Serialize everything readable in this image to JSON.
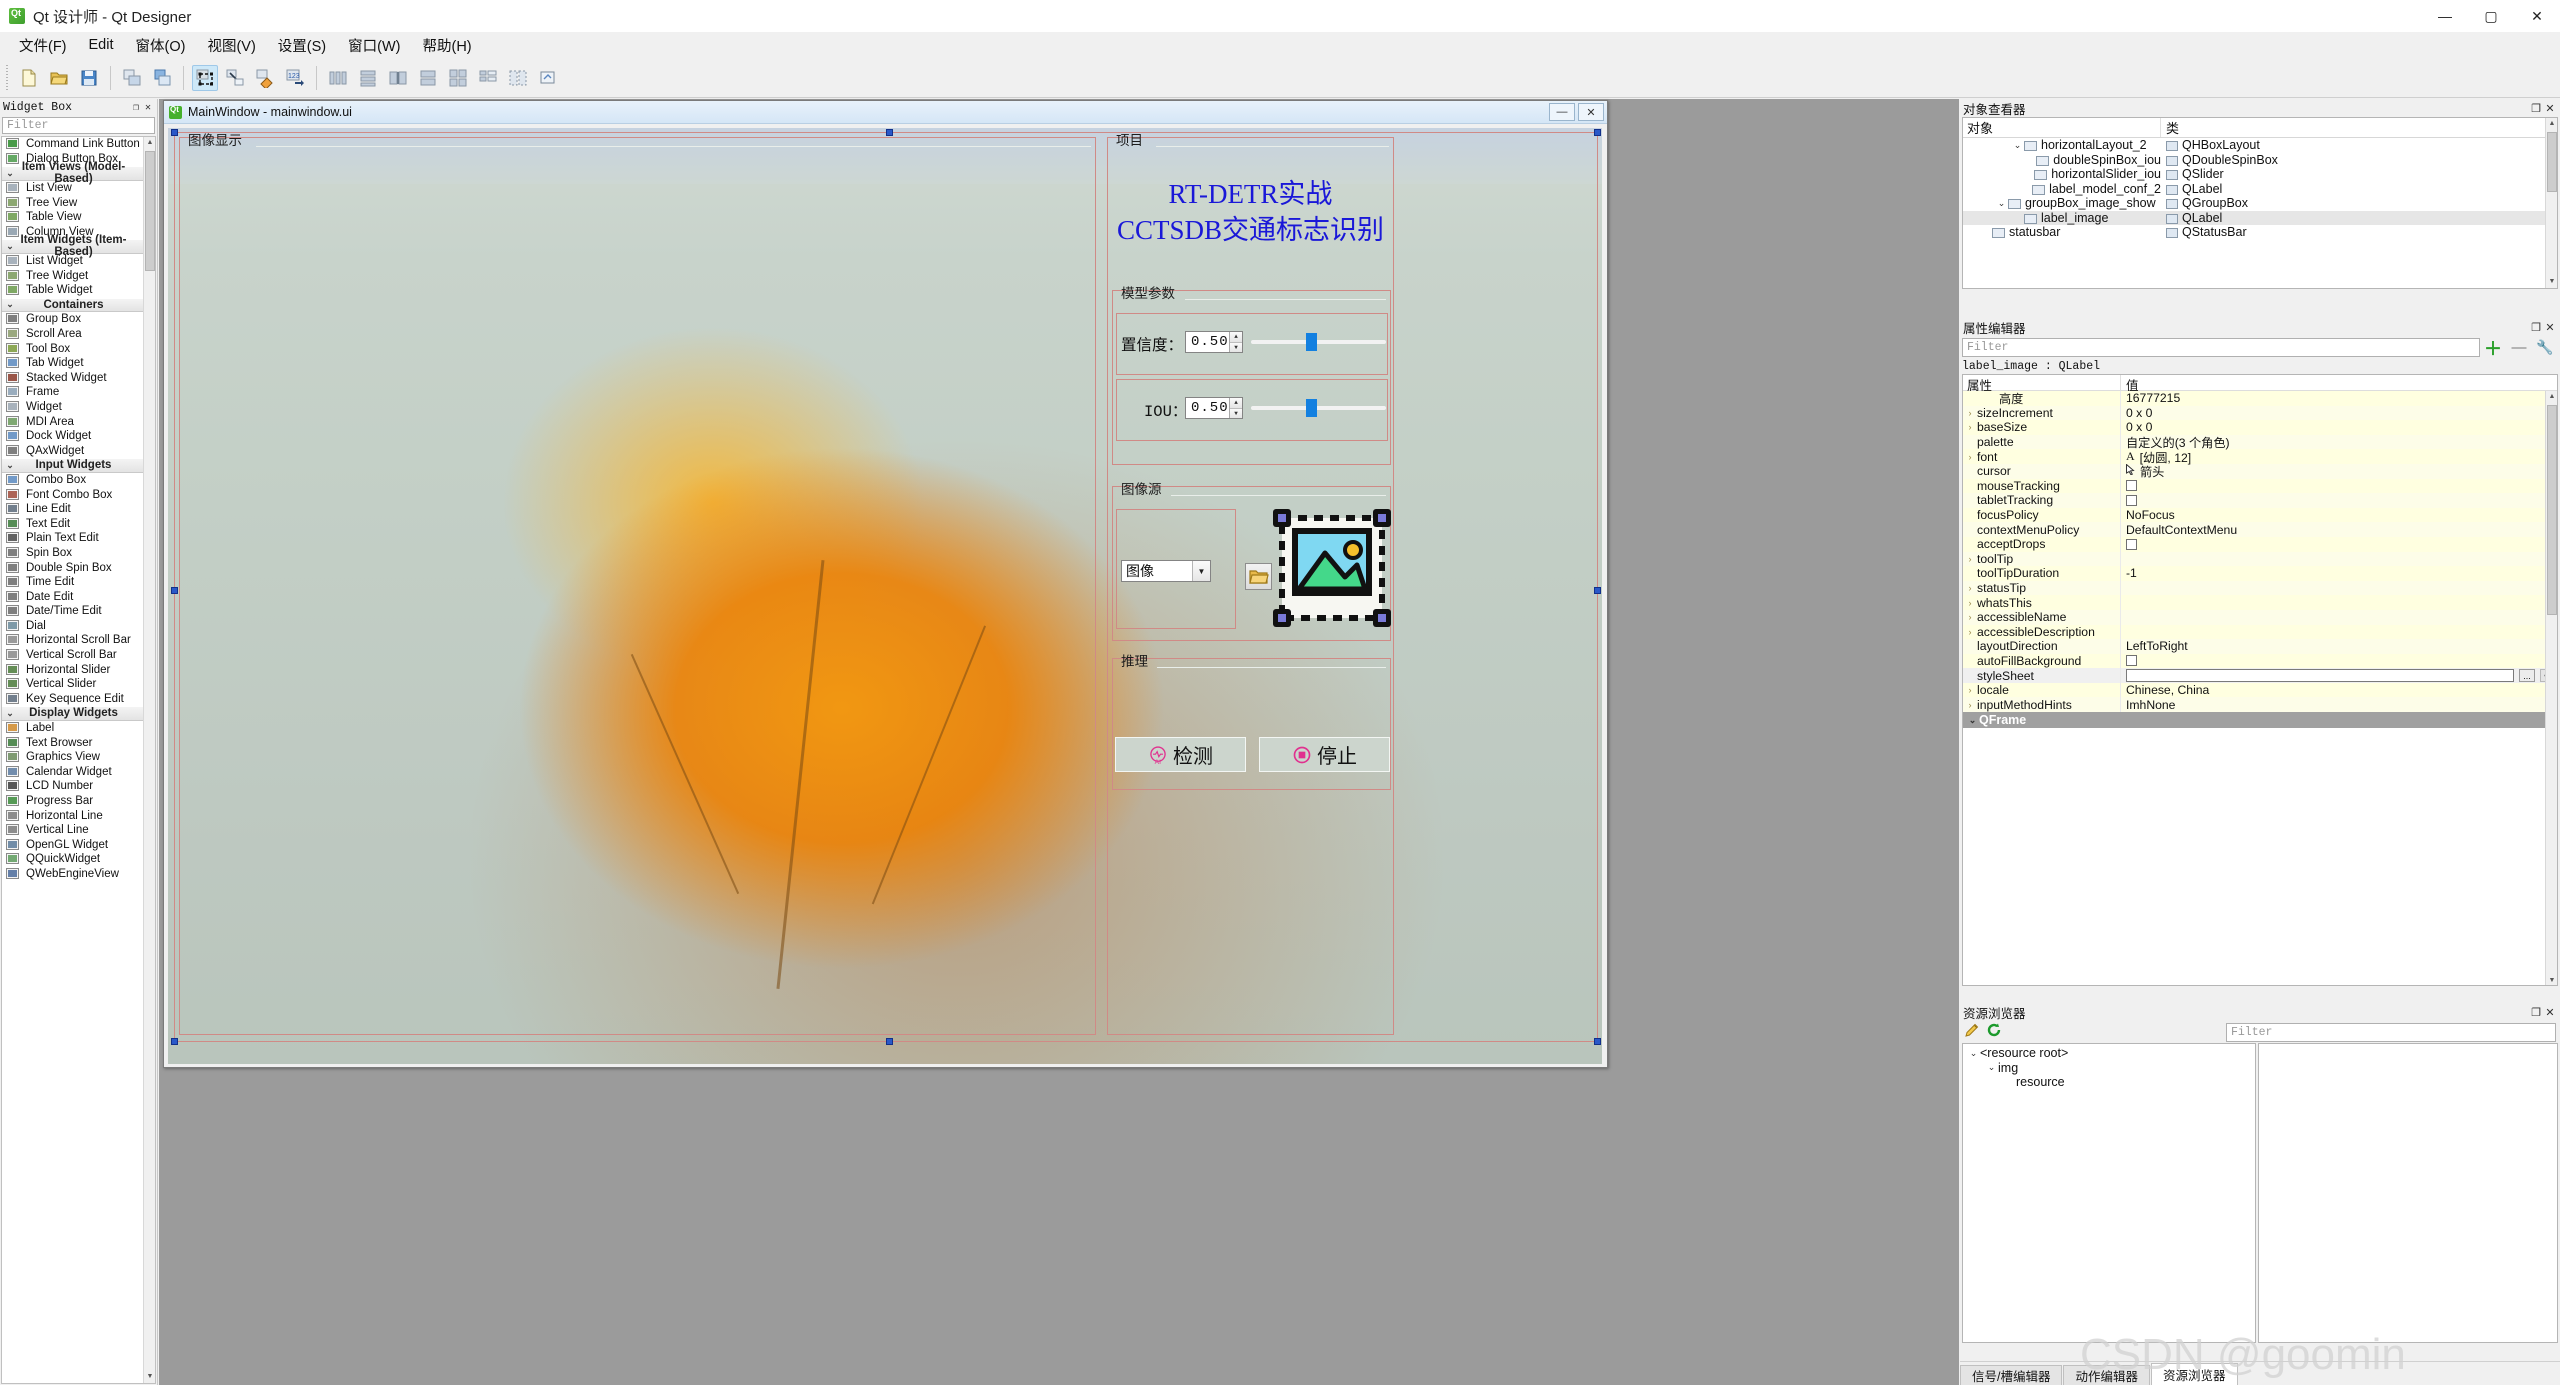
{
  "window": {
    "title": "Qt 设计师 - Qt Designer",
    "icon": "qt-icon",
    "minimize": "—",
    "maximize": "▢",
    "close": "✕"
  },
  "menubar": {
    "items": [
      {
        "label": "文件(F)",
        "name": "menu-file"
      },
      {
        "label": "Edit",
        "name": "menu-edit"
      },
      {
        "label": "窗体(O)",
        "name": "menu-form"
      },
      {
        "label": "视图(V)",
        "name": "menu-view"
      },
      {
        "label": "设置(S)",
        "name": "menu-settings"
      },
      {
        "label": "窗口(W)",
        "name": "menu-window"
      },
      {
        "label": "帮助(H)",
        "name": "menu-help"
      }
    ]
  },
  "toolbar": {
    "buttons": [
      {
        "name": "new-form-button",
        "icon": "new-file-icon"
      },
      {
        "name": "open-form-button",
        "icon": "open-folder-icon"
      },
      {
        "name": "save-form-button",
        "icon": "save-disk-icon"
      },
      {
        "name": "cut-copy-button",
        "icon": "copy-windows-icon"
      },
      {
        "name": "paste-button",
        "icon": "paste-window-icon"
      },
      {
        "name": "edit-widgets-button",
        "icon": "edit-widgets-icon",
        "active": true
      },
      {
        "name": "edit-signals-slots-button",
        "icon": "signal-slot-icon"
      },
      {
        "name": "edit-buddies-button",
        "icon": "buddy-icon"
      },
      {
        "name": "edit-tab-order-button",
        "icon": "tab-order-icon"
      },
      {
        "name": "layout-horizontally-button",
        "icon": "layout-h-icon"
      },
      {
        "name": "layout-vertically-button",
        "icon": "layout-v-icon"
      },
      {
        "name": "layout-splitter-h-button",
        "icon": "splitter-h-icon"
      },
      {
        "name": "layout-splitter-v-button",
        "icon": "splitter-v-icon"
      },
      {
        "name": "layout-grid-button",
        "icon": "layout-grid-icon"
      },
      {
        "name": "layout-form-button",
        "icon": "layout-form-icon"
      },
      {
        "name": "break-layout-button",
        "icon": "break-layout-icon"
      },
      {
        "name": "adjust-size-button",
        "icon": "adjust-size-icon"
      }
    ]
  },
  "widget_box": {
    "title": "Widget Box",
    "filter_placeholder": "Filter",
    "float_button": "❐",
    "close_button": "✕",
    "entries": [
      {
        "type": "item",
        "label": "Command Link Button",
        "icon": "command-link-icon"
      },
      {
        "type": "item",
        "label": "Dialog Button Box",
        "icon": "dialog-buttonbox-icon"
      },
      {
        "type": "group",
        "label": "Item Views (Model-Based)",
        "chevron": "⌄"
      },
      {
        "type": "item",
        "label": "List View",
        "icon": "list-view-icon"
      },
      {
        "type": "item",
        "label": "Tree View",
        "icon": "tree-view-icon"
      },
      {
        "type": "item",
        "label": "Table View",
        "icon": "table-view-icon"
      },
      {
        "type": "item",
        "label": "Column View",
        "icon": "column-view-icon"
      },
      {
        "type": "group",
        "label": "Item Widgets (Item-Based)",
        "chevron": "⌄"
      },
      {
        "type": "item",
        "label": "List Widget",
        "icon": "list-widget-icon"
      },
      {
        "type": "item",
        "label": "Tree Widget",
        "icon": "tree-widget-icon"
      },
      {
        "type": "item",
        "label": "Table Widget",
        "icon": "table-widget-icon"
      },
      {
        "type": "group",
        "label": "Containers",
        "chevron": "⌄"
      },
      {
        "type": "item",
        "label": "Group Box",
        "icon": "group-box-icon"
      },
      {
        "type": "item",
        "label": "Scroll Area",
        "icon": "scroll-area-icon"
      },
      {
        "type": "item",
        "label": "Tool Box",
        "icon": "tool-box-icon"
      },
      {
        "type": "item",
        "label": "Tab Widget",
        "icon": "tab-widget-icon"
      },
      {
        "type": "item",
        "label": "Stacked Widget",
        "icon": "stacked-widget-icon"
      },
      {
        "type": "item",
        "label": "Frame",
        "icon": "frame-icon"
      },
      {
        "type": "item",
        "label": "Widget",
        "icon": "widget-icon"
      },
      {
        "type": "item",
        "label": "MDI Area",
        "icon": "mdi-area-icon"
      },
      {
        "type": "item",
        "label": "Dock Widget",
        "icon": "dock-widget-icon"
      },
      {
        "type": "item",
        "label": "QAxWidget",
        "icon": "qaxwidget-icon"
      },
      {
        "type": "group",
        "label": "Input Widgets",
        "chevron": "⌄"
      },
      {
        "type": "item",
        "label": "Combo Box",
        "icon": "combo-box-icon"
      },
      {
        "type": "item",
        "label": "Font Combo Box",
        "icon": "font-combo-box-icon"
      },
      {
        "type": "item",
        "label": "Line Edit",
        "icon": "line-edit-icon"
      },
      {
        "type": "item",
        "label": "Text Edit",
        "icon": "text-edit-icon"
      },
      {
        "type": "item",
        "label": "Plain Text Edit",
        "icon": "plain-text-edit-icon"
      },
      {
        "type": "item",
        "label": "Spin Box",
        "icon": "spin-box-icon"
      },
      {
        "type": "item",
        "label": "Double Spin Box",
        "icon": "double-spin-box-icon"
      },
      {
        "type": "item",
        "label": "Time Edit",
        "icon": "time-edit-icon"
      },
      {
        "type": "item",
        "label": "Date Edit",
        "icon": "date-edit-icon"
      },
      {
        "type": "item",
        "label": "Date/Time Edit",
        "icon": "datetime-edit-icon"
      },
      {
        "type": "item",
        "label": "Dial",
        "icon": "dial-icon"
      },
      {
        "type": "item",
        "label": "Horizontal Scroll Bar",
        "icon": "hscrollbar-icon"
      },
      {
        "type": "item",
        "label": "Vertical Scroll Bar",
        "icon": "vscrollbar-icon"
      },
      {
        "type": "item",
        "label": "Horizontal Slider",
        "icon": "hslider-icon"
      },
      {
        "type": "item",
        "label": "Vertical Slider",
        "icon": "vslider-icon"
      },
      {
        "type": "item",
        "label": "Key Sequence Edit",
        "icon": "key-sequence-icon"
      },
      {
        "type": "group",
        "label": "Display Widgets",
        "chevron": "⌄"
      },
      {
        "type": "item",
        "label": "Label",
        "icon": "label-icon"
      },
      {
        "type": "item",
        "label": "Text Browser",
        "icon": "text-browser-icon"
      },
      {
        "type": "item",
        "label": "Graphics View",
        "icon": "graphics-view-icon"
      },
      {
        "type": "item",
        "label": "Calendar Widget",
        "icon": "calendar-widget-icon"
      },
      {
        "type": "item",
        "label": "LCD Number",
        "icon": "lcd-number-icon"
      },
      {
        "type": "item",
        "label": "Progress Bar",
        "icon": "progress-bar-icon"
      },
      {
        "type": "item",
        "label": "Horizontal Line",
        "icon": "hline-icon"
      },
      {
        "type": "item",
        "label": "Vertical Line",
        "icon": "vline-icon"
      },
      {
        "type": "item",
        "label": "OpenGL Widget",
        "icon": "opengl-widget-icon"
      },
      {
        "type": "item",
        "label": "QQuickWidget",
        "icon": "qquickwidget-icon"
      },
      {
        "type": "item",
        "label": "QWebEngineView",
        "icon": "qwebengineview-icon"
      }
    ]
  },
  "form_window": {
    "title": "MainWindow - mainwindow.ui",
    "icon": "qt-icon",
    "minimize": "—",
    "close": "✕",
    "left_group_title": "图像显示",
    "right_group_title": "项目",
    "app_title_line1": "RT-DETR实战",
    "app_title_line2": "CCTSDB交通标志识别",
    "model_params": {
      "group_title": "模型参数",
      "conf_label": "置信度：",
      "conf_value": "0.50",
      "iou_label": "IOU：",
      "iou_value": "0.50"
    },
    "image_source": {
      "group_title": "图像源",
      "combo_value": "图像",
      "combo_arrow": "▼",
      "browse_icon": "open-folder-icon",
      "placeholder_icon": "image-placeholder-icon"
    },
    "inference": {
      "group_title": "推理",
      "detect_label": "检测",
      "detect_icon": "ai-detect-icon",
      "stop_label": "停止",
      "stop_icon": "stop-circle-icon"
    }
  },
  "object_inspector": {
    "title": "对象查看器",
    "float_button": "❐",
    "close_button": "✕",
    "columns": [
      "对象",
      "类"
    ],
    "rows": [
      {
        "indent": 3,
        "chevron": "⌄",
        "object": "horizontalLayout_2",
        "class": "QHBoxLayout",
        "icon": "hbox-layout-icon",
        "selected": false
      },
      {
        "indent": 4,
        "chevron": "",
        "object": "doubleSpinBox_iou",
        "class": "QDoubleSpinBox",
        "icon": "double-spin-box-icon",
        "selected": false
      },
      {
        "indent": 4,
        "chevron": "",
        "object": "horizontalSlider_iou",
        "class": "QSlider",
        "icon": "hslider-icon",
        "selected": false
      },
      {
        "indent": 4,
        "chevron": "",
        "object": "label_model_conf_2",
        "class": "QLabel",
        "icon": "label-icon",
        "selected": false
      },
      {
        "indent": 2,
        "chevron": "⌄",
        "object": "groupBox_image_show",
        "class": "QGroupBox",
        "icon": "group-box-icon",
        "selected": false
      },
      {
        "indent": 3,
        "chevron": "",
        "object": "label_image",
        "class": "QLabel",
        "icon": "label-icon",
        "selected": true
      },
      {
        "indent": 1,
        "chevron": "",
        "object": "statusbar",
        "class": "QStatusBar",
        "icon": "statusbar-icon",
        "selected": false
      }
    ]
  },
  "property_editor": {
    "title": "属性编辑器",
    "float_button": "❐",
    "close_button": "✕",
    "filter_placeholder": "Filter",
    "add_button": "＋",
    "remove_button": "—",
    "configure_button": "🔧",
    "object_line": "label_image : QLabel",
    "columns": [
      "属性",
      "值"
    ],
    "rows": [
      {
        "expand": "",
        "name": "高度",
        "value": "16777215",
        "kind": "text",
        "indent": true
      },
      {
        "expand": "›",
        "name": "sizeIncrement",
        "value": "0 x 0",
        "kind": "text"
      },
      {
        "expand": "›",
        "name": "baseSize",
        "value": "0 x 0",
        "kind": "text"
      },
      {
        "expand": "",
        "name": "palette",
        "value": "自定义的(3 个角色)",
        "kind": "text"
      },
      {
        "expand": "›",
        "name": "font",
        "value": "[幼圆, 12]",
        "kind": "font"
      },
      {
        "expand": "",
        "name": "cursor",
        "value": "箭头",
        "kind": "cursor"
      },
      {
        "expand": "",
        "name": "mouseTracking",
        "value": "",
        "kind": "checkbox"
      },
      {
        "expand": "",
        "name": "tabletTracking",
        "value": "",
        "kind": "checkbox"
      },
      {
        "expand": "",
        "name": "focusPolicy",
        "value": "NoFocus",
        "kind": "text"
      },
      {
        "expand": "",
        "name": "contextMenuPolicy",
        "value": "DefaultContextMenu",
        "kind": "text"
      },
      {
        "expand": "",
        "name": "acceptDrops",
        "value": "",
        "kind": "checkbox"
      },
      {
        "expand": "›",
        "name": "toolTip",
        "value": "",
        "kind": "text"
      },
      {
        "expand": "",
        "name": "toolTipDuration",
        "value": "-1",
        "kind": "text"
      },
      {
        "expand": "›",
        "name": "statusTip",
        "value": "",
        "kind": "text"
      },
      {
        "expand": "›",
        "name": "whatsThis",
        "value": "",
        "kind": "text"
      },
      {
        "expand": "›",
        "name": "accessibleName",
        "value": "",
        "kind": "text"
      },
      {
        "expand": "›",
        "name": "accessibleDescription",
        "value": "",
        "kind": "text"
      },
      {
        "expand": "",
        "name": "layoutDirection",
        "value": "LeftToRight",
        "kind": "text"
      },
      {
        "expand": "",
        "name": "autoFillBackground",
        "value": "",
        "kind": "checkbox"
      },
      {
        "expand": "",
        "name": "styleSheet",
        "value": "",
        "kind": "stylesheet",
        "ellipsis": "...",
        "reset": "↩"
      },
      {
        "expand": "›",
        "name": "locale",
        "value": "Chinese, China",
        "kind": "text"
      },
      {
        "expand": "›",
        "name": "inputMethodHints",
        "value": "ImhNone",
        "kind": "text"
      }
    ],
    "section_row": {
      "chevron": "⌄",
      "label": "QFrame"
    }
  },
  "resource_browser": {
    "title": "资源浏览器",
    "float_button": "❐",
    "close_button": "✕",
    "edit_icon": "pencil-icon",
    "reload_icon": "reload-icon",
    "filter_placeholder": "Filter",
    "tree": [
      {
        "indent": 0,
        "chevron": "⌄",
        "label": "<resource root>"
      },
      {
        "indent": 1,
        "chevron": "⌄",
        "label": "img"
      },
      {
        "indent": 2,
        "chevron": "",
        "label": "resource"
      }
    ]
  },
  "bottom_tabs": {
    "items": [
      {
        "label": "信号/槽编辑器",
        "name": "tab-signal-slot-editor",
        "active": false
      },
      {
        "label": "动作编辑器",
        "name": "tab-action-editor",
        "active": false
      },
      {
        "label": "资源浏览器",
        "name": "tab-resource-browser",
        "active": true
      }
    ]
  },
  "watermark": "CSDN @goomin",
  "colors": {
    "accent_blue": "#1380e0",
    "title_text_blue": "#1a18d8",
    "selection_handle": "#2a58c8",
    "group_border": "#d08a86",
    "prop_row_yellow": "#ffffe0"
  }
}
